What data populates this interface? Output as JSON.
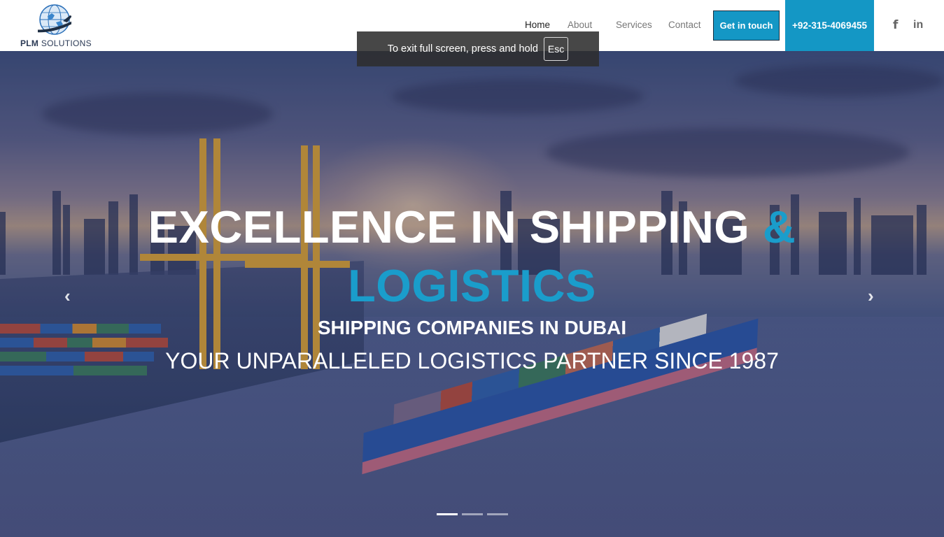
{
  "brand": {
    "name_bold": "PLM",
    "name_rest": " SOLUTIONS"
  },
  "nav": {
    "items": [
      {
        "label": "Home",
        "active": true
      },
      {
        "label": "About"
      },
      {
        "label": "Services"
      },
      {
        "label": "Contact"
      }
    ],
    "cta_label": "Get in touch",
    "phone_label": "+92-315-4069455"
  },
  "social": {
    "facebook": "f",
    "linkedin": "in"
  },
  "toast": {
    "text": "To exit full screen, press and hold",
    "key": "Esc"
  },
  "hero": {
    "title_white": "EXCELLENCE IN SHIPPING ",
    "title_accent_amp": "&",
    "title_accent_line2": "LOGISTICS",
    "subtitle1": "SHIPPING COMPANIES IN DUBAI",
    "subtitle2": "YOUR UNPARALLELED LOGISTICS PARTNER SINCE 1987",
    "prev_icon": "‹",
    "next_icon": "›",
    "slides_count": 3,
    "active_slide": 1
  },
  "colors": {
    "accent": "#1497c5",
    "accent_text": "#1a9dcb"
  }
}
